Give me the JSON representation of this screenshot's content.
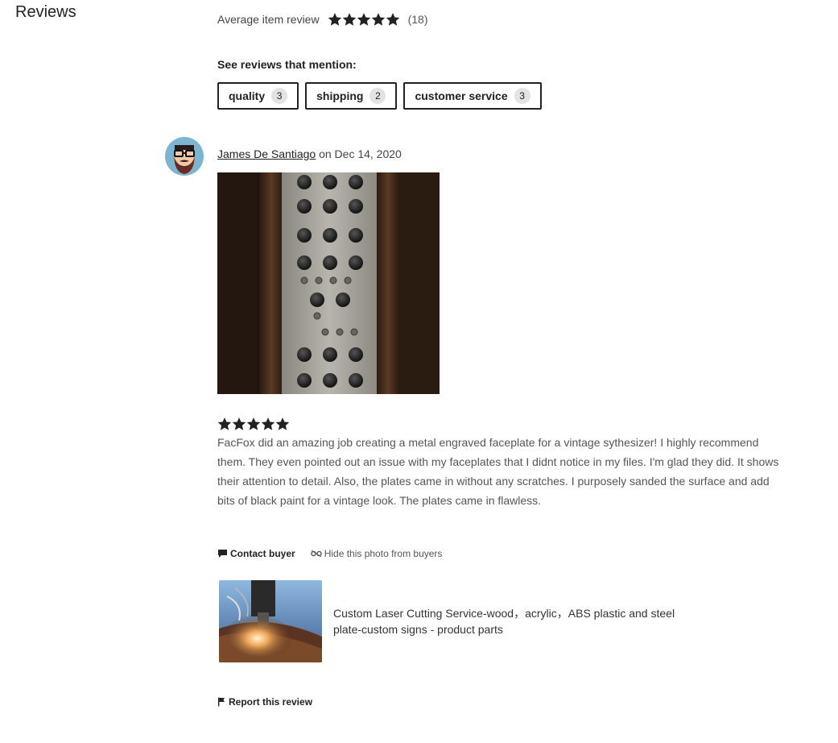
{
  "section": {
    "title": "Reviews"
  },
  "average": {
    "label": "Average item review",
    "rating": 5,
    "rating_max": 5,
    "count": "(18)"
  },
  "mentions": {
    "title": "See reviews that mention:",
    "chips": [
      {
        "label": "quality",
        "count": "3"
      },
      {
        "label": "shipping",
        "count": "2"
      },
      {
        "label": "customer service",
        "count": "3"
      }
    ]
  },
  "review": {
    "reviewer": "James De Santiago",
    "on": "on",
    "date": "Dec 14, 2020",
    "rating": 5,
    "text": "FacFox did an amazing job creating a metal engraved faceplate for a vintage sythesizer! I highly recommend them. They even pointed out an issue with my faceplates that I didnt notice in my files. I'm glad they did. It shows their attention to detail. Also, the plates came in without any scratches. I purposely sanded the surface and add bits of black paint for a vintage look. The plates came in flawless.",
    "actions": {
      "contact": "Contact buyer",
      "hide": "Hide this photo from buyers"
    },
    "product": {
      "title": "Custom Laser Cutting Service-wood，acrylic，ABS plastic and steel plate-custom signs - product parts"
    },
    "report": "Report this review"
  },
  "icons": {
    "star": "star-icon",
    "contact": "message-icon",
    "hide": "glasses-slash-icon",
    "report": "flag-icon"
  },
  "colors": {
    "text": "#222222",
    "muted": "#555555",
    "chip_count_bg": "#e3e3e3"
  }
}
